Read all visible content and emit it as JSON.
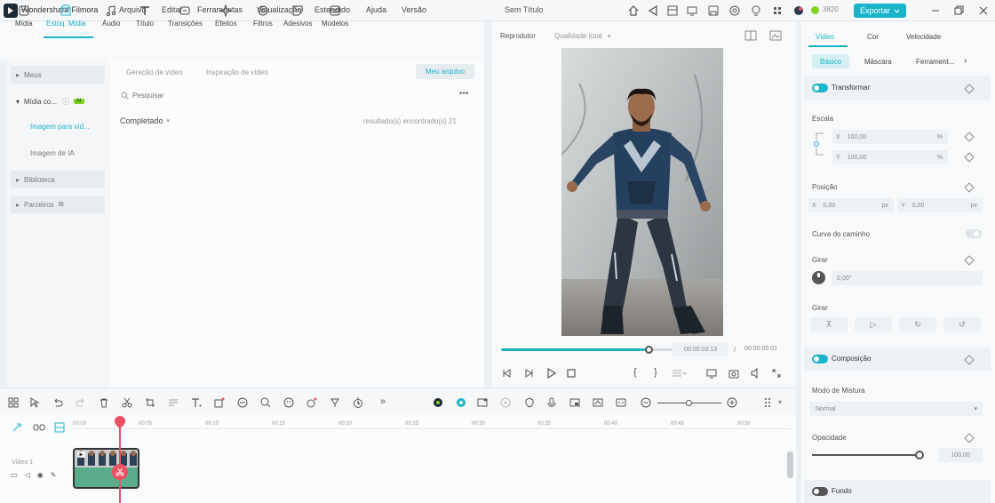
{
  "app": {
    "name": "Wondershare Filmora",
    "project_title": "Sem Título",
    "credits": "3820",
    "export_label": "Exportar"
  },
  "menu": [
    "Arquivo",
    "Editar",
    "Ferramentas",
    "Visualização",
    "Estendido",
    "Ajuda",
    "Versão"
  ],
  "media_tools": [
    {
      "label": "Mídia",
      "icon": "media-icon"
    },
    {
      "label": "Estoq. Mídia",
      "icon": "stock-media-icon",
      "active": true
    },
    {
      "label": "Áudio",
      "icon": "audio-icon"
    },
    {
      "label": "Título",
      "icon": "title-icon"
    },
    {
      "label": "Transições",
      "icon": "transitions-icon"
    },
    {
      "label": "Efeitos",
      "icon": "effects-icon"
    },
    {
      "label": "Filtros",
      "icon": "filters-icon"
    },
    {
      "label": "Adesivos",
      "icon": "stickers-icon"
    },
    {
      "label": "Modelos",
      "icon": "templates-icon"
    }
  ],
  "sidebar": {
    "items": [
      {
        "label": "Meus"
      },
      {
        "label": "Mídia co...",
        "badge": "AI"
      },
      {
        "label": "Imagem para víd..."
      },
      {
        "label": "Imagem de IA"
      },
      {
        "label": "Biblioteca"
      },
      {
        "label": "Parceiros"
      }
    ]
  },
  "library": {
    "tabs": [
      "Geração de vídeo",
      "Inspiração de vídeo"
    ],
    "my_files_button": "Meu arquivo",
    "search_placeholder": "Pesquisar",
    "filter_label": "Completado",
    "results_text": "resultado(s) encontrado(s) 21"
  },
  "player": {
    "label": "Reprodutor",
    "quality": "Qualidade total",
    "current_time": "00:00:03:13",
    "separator": "/",
    "total_time": "00:00:05:01",
    "progress": 0.72
  },
  "panel": {
    "tabs": [
      "Vídeo",
      "Cor",
      "Velocidade"
    ],
    "subtabs": [
      "Básico",
      "Máscara",
      "Ferrament..."
    ],
    "transform": {
      "title": "Transformar",
      "scale_label": "Escala",
      "scale_x_axis": "X",
      "scale_x": "100,00",
      "scale_y_axis": "Y",
      "scale_y": "100,00",
      "percent": "%",
      "position_label": "Posição",
      "pos_x_axis": "X",
      "pos_x": "0,00",
      "pos_y_axis": "Y",
      "pos_y": "0,00",
      "px": "px",
      "path_curve_label": "Curva do caminho",
      "rotate_label": "Girar",
      "rotate_value": "0,00°",
      "flip_label": "Girar"
    },
    "composition": {
      "title": "Composição",
      "blend_label": "Modo de Mistura",
      "blend_value": "Normal",
      "opacity_label": "Opacidade",
      "opacity_value": "100,00",
      "opacity": 1.0
    },
    "background_title": "Fundo"
  },
  "timeline": {
    "track_label": "Vídeo 1",
    "ruler": [
      "00:00",
      "00:05",
      "00:10",
      "00:15",
      "00:20",
      "00:25",
      "00:30",
      "00:35",
      "00:40",
      "00:45",
      "00:50"
    ]
  },
  "colors": {
    "accent": "#19b4c7",
    "playhead": "#ef4f63",
    "clip": "#59ad8d",
    "ai_badge": "#7fd321"
  }
}
